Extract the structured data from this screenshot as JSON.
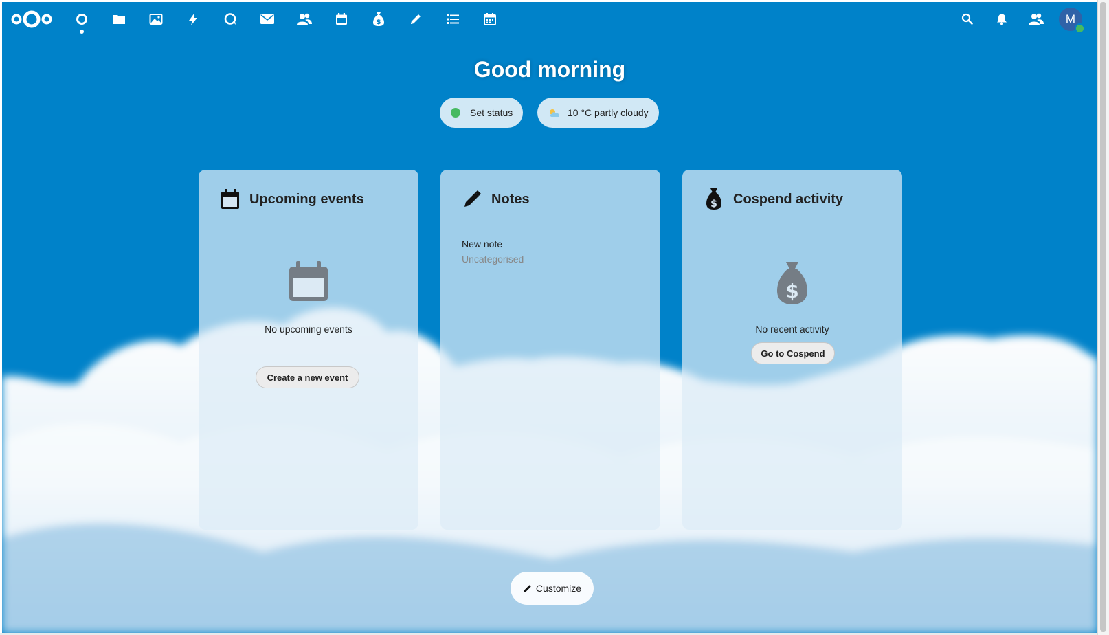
{
  "header": {
    "logo_icon": "nextcloud-logo",
    "nav": [
      {
        "name": "dashboard",
        "icon": "dashboard-icon",
        "active": true
      },
      {
        "name": "files",
        "icon": "folder-icon"
      },
      {
        "name": "photos",
        "icon": "image-icon"
      },
      {
        "name": "activity",
        "icon": "lightning-icon"
      },
      {
        "name": "talk",
        "icon": "chat-bubble-icon"
      },
      {
        "name": "mail",
        "icon": "envelope-icon"
      },
      {
        "name": "contacts",
        "icon": "contacts-icon"
      },
      {
        "name": "calendar",
        "icon": "calendar-icon"
      },
      {
        "name": "cospend",
        "icon": "money-bag-icon"
      },
      {
        "name": "notes",
        "icon": "pencil-icon"
      },
      {
        "name": "tasks",
        "icon": "checklist-icon"
      },
      {
        "name": "deck",
        "icon": "calendar-grid-icon"
      }
    ],
    "right": [
      "search-icon",
      "bell-icon",
      "contacts-menu-icon"
    ],
    "avatar_initial": "M"
  },
  "greeting": "Good morning",
  "status": {
    "set_status_label": "Set status",
    "weather_label": "10 °C partly cloudy",
    "status_color": "#46ba61"
  },
  "panels": {
    "events": {
      "title": "Upcoming events",
      "empty_text": "No upcoming events",
      "button_label": "Create a new event"
    },
    "notes": {
      "title": "Notes",
      "items": [
        {
          "title": "New note",
          "category": "Uncategorised"
        }
      ]
    },
    "cospend": {
      "title": "Cospend activity",
      "empty_text": "No recent activity",
      "button_label": "Go to Cospend"
    }
  },
  "customize_label": "Customize",
  "colors": {
    "primary": "#0082c9",
    "status_online": "#46ba61"
  }
}
